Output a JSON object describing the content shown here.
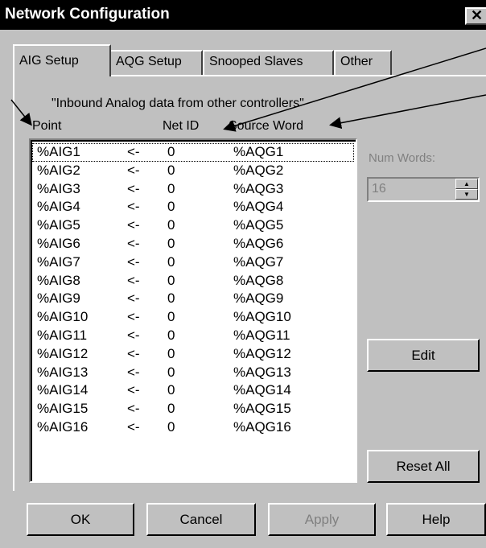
{
  "window": {
    "title": "Network Configuration",
    "close_label": "✕"
  },
  "tabs": [
    {
      "label": "AIG Setup",
      "active": true
    },
    {
      "label": "AQG Setup",
      "active": false
    },
    {
      "label": "Snooped Slaves",
      "active": false
    },
    {
      "label": "Other",
      "active": false
    }
  ],
  "panel": {
    "caption": "\"Inbound Analog data from other controllers\"",
    "columns": {
      "point": "Point",
      "net_id": "Net ID",
      "source_word": "Source Word"
    },
    "rows": [
      {
        "point": "%AIG1",
        "arrow": "<-",
        "net_id": "0",
        "source": "%AQG1"
      },
      {
        "point": "%AIG2",
        "arrow": "<-",
        "net_id": "0",
        "source": "%AQG2"
      },
      {
        "point": "%AIG3",
        "arrow": "<-",
        "net_id": "0",
        "source": "%AQG3"
      },
      {
        "point": "%AIG4",
        "arrow": "<-",
        "net_id": "0",
        "source": "%AQG4"
      },
      {
        "point": "%AIG5",
        "arrow": "<-",
        "net_id": "0",
        "source": "%AQG5"
      },
      {
        "point": "%AIG6",
        "arrow": "<-",
        "net_id": "0",
        "source": "%AQG6"
      },
      {
        "point": "%AIG7",
        "arrow": "<-",
        "net_id": "0",
        "source": "%AQG7"
      },
      {
        "point": "%AIG8",
        "arrow": "<-",
        "net_id": "0",
        "source": "%AQG8"
      },
      {
        "point": "%AIG9",
        "arrow": "<-",
        "net_id": "0",
        "source": "%AQG9"
      },
      {
        "point": "%AIG10",
        "arrow": "<-",
        "net_id": "0",
        "source": "%AQG10"
      },
      {
        "point": "%AIG11",
        "arrow": "<-",
        "net_id": "0",
        "source": "%AQG11"
      },
      {
        "point": "%AIG12",
        "arrow": "<-",
        "net_id": "0",
        "source": "%AQG12"
      },
      {
        "point": "%AIG13",
        "arrow": "<-",
        "net_id": "0",
        "source": "%AQG13"
      },
      {
        "point": "%AIG14",
        "arrow": "<-",
        "net_id": "0",
        "source": "%AQG14"
      },
      {
        "point": "%AIG15",
        "arrow": "<-",
        "net_id": "0",
        "source": "%AQG15"
      },
      {
        "point": "%AIG16",
        "arrow": "<-",
        "net_id": "0",
        "source": "%AQG16"
      }
    ],
    "num_words": {
      "label": "Num Words:",
      "value": "16"
    },
    "edit_label": "Edit",
    "reset_all_label": "Reset All"
  },
  "footer": {
    "ok": "OK",
    "cancel": "Cancel",
    "apply": "Apply",
    "help": "Help"
  },
  "colors": {
    "titlebar": "#000000",
    "face": "#c0c0c0",
    "disabled_text": "#808080"
  }
}
